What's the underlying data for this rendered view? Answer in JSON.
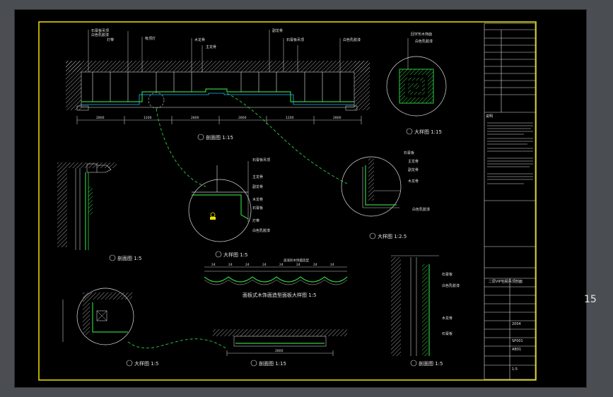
{
  "page": {
    "number": "15"
  },
  "drawings": [
    {
      "id": "ceiling-section",
      "title": "剖面图 1:15",
      "tag": "SECTION"
    },
    {
      "id": "square-detail",
      "title": "大样图 1:15",
      "tag": "DETAIL"
    },
    {
      "id": "left-section",
      "title": "剖面图 1:5",
      "tag": "SECTION"
    },
    {
      "id": "center-detail",
      "title": "大样图 1:5",
      "tag": "DETAIL"
    },
    {
      "id": "right-detail",
      "title": "大样图 1:2.5",
      "tag": "DETAIL"
    },
    {
      "id": "wave-ceiling",
      "title": "面板式木饰面造型面板大样图 1:5",
      "tag": "DETAIL"
    },
    {
      "id": "bottom-left-detail",
      "title": "大样图 1:5",
      "tag": "DETAIL"
    },
    {
      "id": "bottom-center-section",
      "title": "剖面图 1:15",
      "tag": "SECTION"
    },
    {
      "id": "bottom-right-section",
      "title": "剖面图 1:5",
      "tag": "SECTION"
    }
  ],
  "annotations": {
    "top": [
      "石膏板吊顶",
      "白色乳胶漆",
      "灯带",
      "吸顶灯",
      "木龙骨",
      "主龙骨",
      "副龙骨",
      "石膏板吊顶",
      "白色乳胶漆"
    ],
    "square": [
      "回字形木饰面",
      "白色乳胶漆"
    ],
    "center": [
      "石膏板吊顶",
      "主龙骨",
      "副龙骨",
      "木龙骨",
      "石膏板",
      "灯带",
      "白色乳胶漆"
    ],
    "right": [
      "石膏板",
      "主龙骨",
      "副龙骨",
      "木龙骨",
      "白色乳胶漆"
    ],
    "wave": [
      "波浪形木饰面造型"
    ],
    "bottom_right": [
      "石膏板",
      "白色乳胶漆",
      "木龙骨",
      "石膏板"
    ]
  },
  "dims": {
    "top": [
      "2800",
      "1200",
      "2800",
      "2800",
      "1200",
      "2800"
    ],
    "wave": [
      "24",
      "24",
      "24",
      "24",
      "24",
      "24",
      "24",
      "24"
    ],
    "bottom": [
      "2800"
    ]
  },
  "title_block": {
    "notes_label": "说明",
    "rows": [
      "二层VIP包厢吊顶剖面",
      "2004",
      "SP001",
      "AB01",
      "1:5"
    ]
  }
}
